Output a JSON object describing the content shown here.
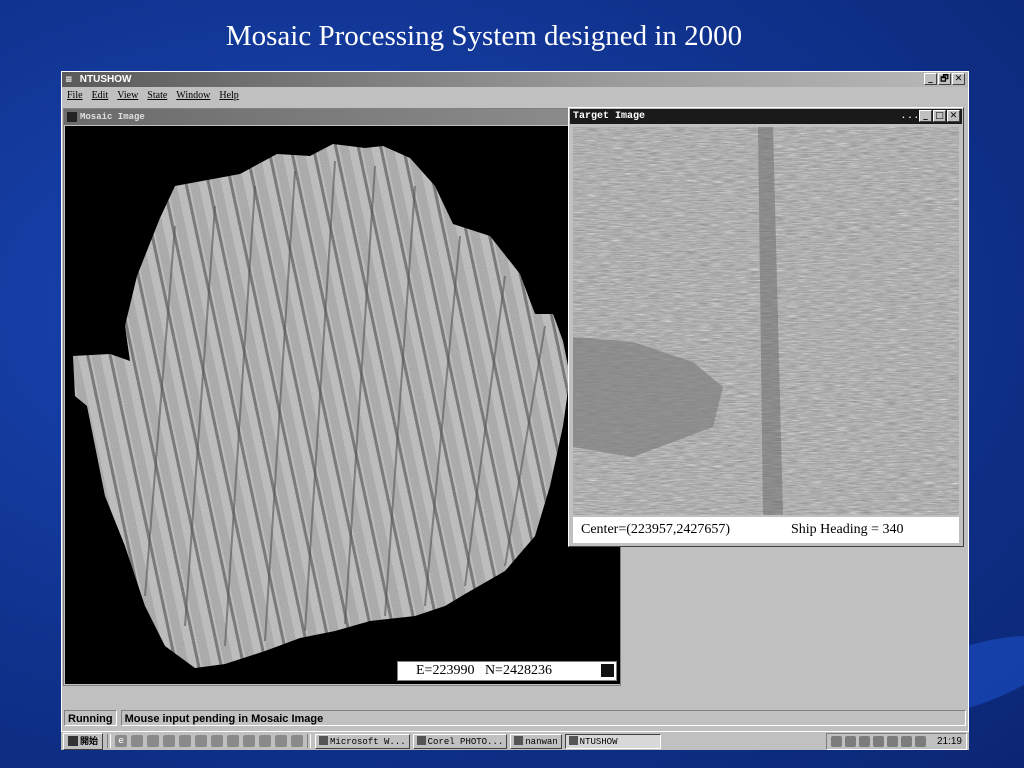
{
  "slide": {
    "title": "Mosaic Processing System designed in 2000"
  },
  "app": {
    "title": "NTUSHOW",
    "window_buttons": {
      "minimize": "_",
      "maximize": "🗗",
      "close": "✕"
    },
    "menu": [
      "File",
      "Edit",
      "View",
      "State",
      "Window",
      "Help"
    ]
  },
  "mosaic_window": {
    "title": "Mosaic Image",
    "coords": "E=223990   N=2428236"
  },
  "target_window": {
    "title": "Target Image",
    "dots": "...",
    "center": "Center=(223957,2427657)",
    "heading": "Ship Heading = 340"
  },
  "status_bar": {
    "state": "Running",
    "message": "Mouse input pending in Mosaic Image"
  },
  "taskbar": {
    "start_label": "開始",
    "quick_launch": [
      "ie-icon",
      "outlook-icon",
      "desktop-icon",
      "media-icon",
      "app-icon",
      "app-icon",
      "app-icon",
      "app-icon",
      "app-icon",
      "app-icon",
      "app-icon",
      "app-icon"
    ],
    "tasks": [
      {
        "label": "Microsoft W...",
        "active": false
      },
      {
        "label": "Corel PHOTO...",
        "active": false
      },
      {
        "label": "nanwan",
        "active": false
      },
      {
        "label": "NTUSHOW",
        "active": true
      }
    ],
    "clock": "21:19"
  },
  "colors": {
    "slide_background": "#10338f",
    "window_face": "#c0c0c0",
    "mosaic_background": "#000000",
    "sonar_gray": "#b4b4b4"
  }
}
